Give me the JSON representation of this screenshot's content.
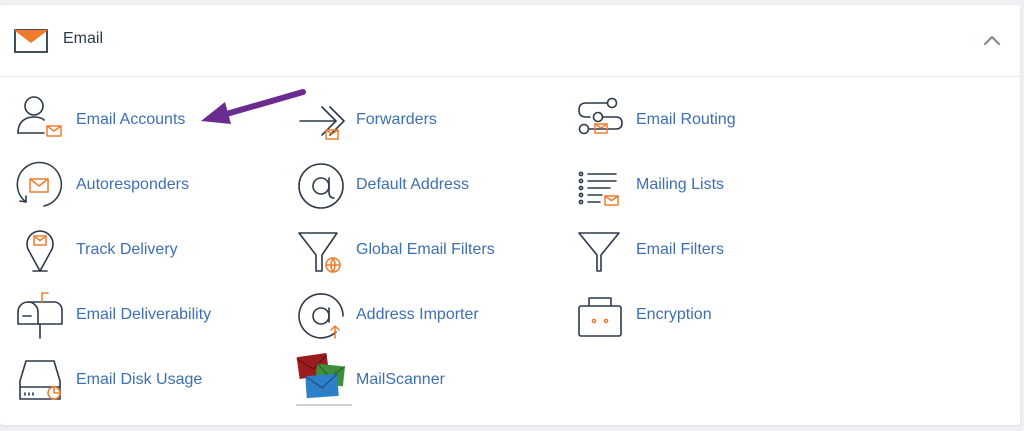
{
  "section": {
    "title": "Email",
    "header_icon": "envelope-icon",
    "collapse_icon": "chevron-up-icon"
  },
  "colors": {
    "link": "#3d6fb4",
    "icon_stroke": "#2c3a4a",
    "icon_accent": "#f07b2d",
    "annotation_arrow": "#6b2b8f"
  },
  "items": [
    {
      "label": "Email Accounts",
      "icon": "user-envelope-icon"
    },
    {
      "label": "Forwarders",
      "icon": "forward-arrows-icon"
    },
    {
      "label": "Email Routing",
      "icon": "routing-icon"
    },
    {
      "label": "Autoresponders",
      "icon": "autoresponder-icon"
    },
    {
      "label": "Default Address",
      "icon": "at-sign-icon"
    },
    {
      "label": "Mailing Lists",
      "icon": "mailing-list-icon"
    },
    {
      "label": "Track Delivery",
      "icon": "map-pin-envelope-icon"
    },
    {
      "label": "Global Email Filters",
      "icon": "funnel-globe-icon"
    },
    {
      "label": "Email Filters",
      "icon": "funnel-icon"
    },
    {
      "label": "Email Deliverability",
      "icon": "mailbox-icon"
    },
    {
      "label": "Address Importer",
      "icon": "at-import-icon"
    },
    {
      "label": "Encryption",
      "icon": "lock-icon"
    },
    {
      "label": "Email Disk Usage",
      "icon": "disk-usage-icon"
    },
    {
      "label": "MailScanner",
      "icon": "mailscanner-logo-icon"
    }
  ]
}
